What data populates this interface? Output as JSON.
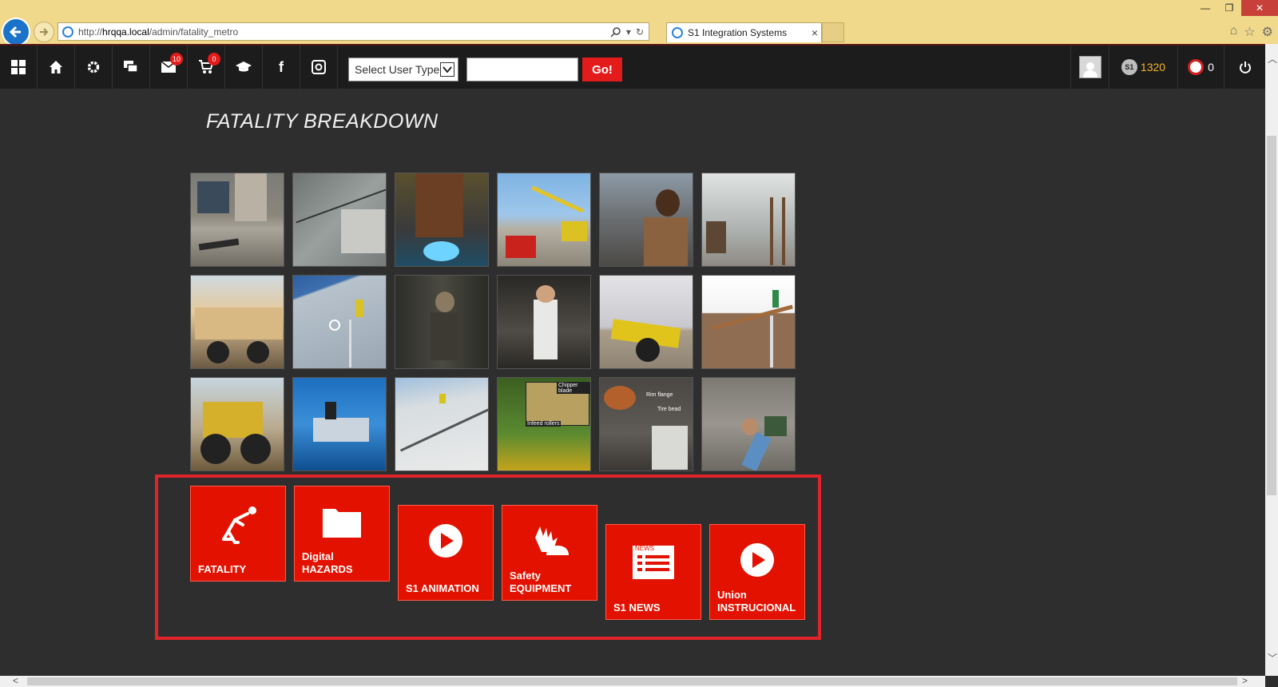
{
  "browser": {
    "url_prefix": "http://",
    "url_host": "hrqqa.local",
    "url_path": "/admin/fatality_metro",
    "tab_title": "S1 Integration Systems"
  },
  "toolbar": {
    "messages_badge": "10",
    "cart_badge": "0",
    "user_type_label": "Select User Type",
    "search_value": "",
    "go_label": "Go!",
    "points": "1320",
    "coin_label": "S1",
    "alerts_count": "0",
    "icons": [
      "apps-icon",
      "home-icon",
      "gear-icon",
      "chat-icon",
      "mail-icon",
      "cart-icon",
      "graduation-cap-icon",
      "facebook-icon",
      "instagram-icon",
      "avatar",
      "points-coin-icon",
      "alert-icon",
      "power-icon"
    ]
  },
  "page": {
    "title": "FATALITY BREAKDOWN"
  },
  "photos": [
    "concrete-site",
    "roof-wires",
    "welder",
    "crane-truck",
    "worker-city",
    "ladder-office",
    "machine-truck",
    "wall-ladder",
    "factory-worker",
    "kitchen-chef",
    "yellow-cart",
    "house-ladders",
    "loader",
    "blue-truck",
    "roof-workers",
    "chipper-blade",
    "tire-rim",
    "fallen-man"
  ],
  "photo_annotations": {
    "chipper_blade": "Chipper blade",
    "infeed_rollers": "Infeed rollers",
    "rim_flange": "Rim flange",
    "tire_bead": "Tire bead"
  },
  "tiles": [
    {
      "label": "FATALITY",
      "icon": "falling-person-icon"
    },
    {
      "label": "Digital\nHAZARDS",
      "icon": "folder-icon"
    },
    {
      "label": "S1 ANIMATION",
      "icon": "play-icon"
    },
    {
      "label": "Safety\nEQUIPMENT",
      "icon": "gloves-hardhat-icon"
    },
    {
      "label": "S1 NEWS",
      "icon": "news-icon"
    },
    {
      "label": "Union\nINSTRUCIONAL",
      "icon": "play-icon"
    }
  ],
  "colors": {
    "accent_red": "#e31200",
    "frame_red": "#e1232a",
    "background": "#2e2e2e",
    "toolbar": "#1c1c1c",
    "points_gold": "#f2b62a",
    "browser_chrome": "#f1d98b"
  }
}
